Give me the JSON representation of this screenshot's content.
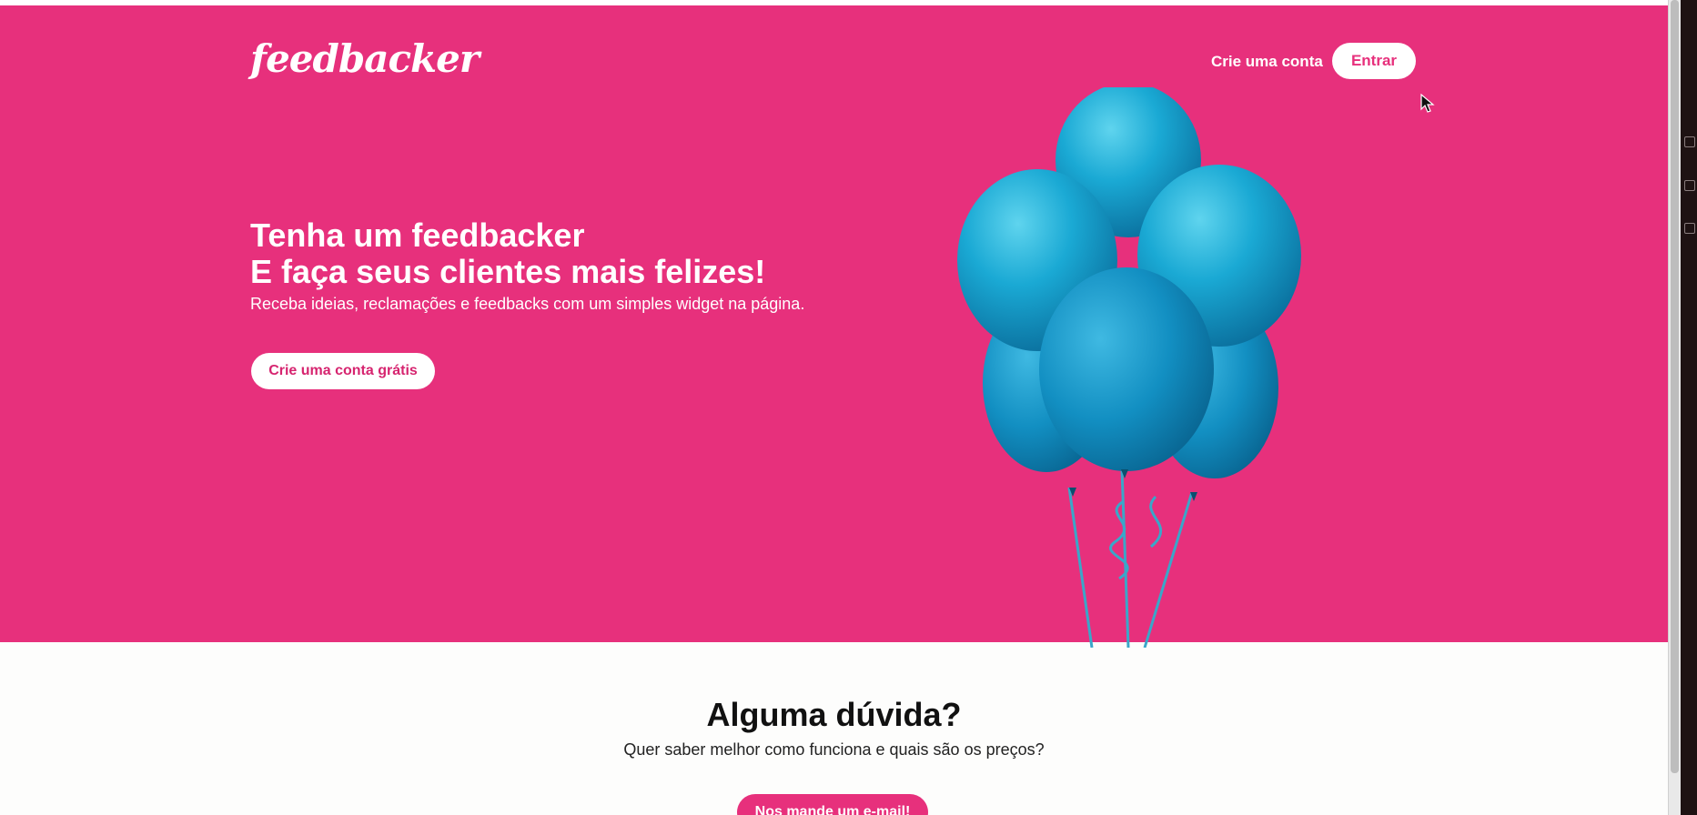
{
  "brand": {
    "logo_text": "feedbacker",
    "primary_color": "#e7307c"
  },
  "nav": {
    "signup_label": "Crie uma conta",
    "login_label": "Entrar"
  },
  "hero": {
    "headline_line1": "Tenha um feedbacker",
    "headline_line2": "E faça seus clientes mais felizes!",
    "subtitle": "Receba ideias, reclamações e feedbacks com um simples widget na página.",
    "cta_label": "Crie uma conta grátis",
    "illustration": "blue-balloons",
    "balloon_color": "#1aa3cf"
  },
  "contact": {
    "title": "Alguma dúvida?",
    "subtitle": "Quer saber melhor como funciona e quais são os preços?",
    "button_label": "Nos mande um e-mail!"
  },
  "icons": {
    "cursor": "mouse-pointer-icon",
    "side_panel": [
      "settings-icon",
      "extension-icon",
      "layout-icon",
      "brush-icon"
    ]
  }
}
